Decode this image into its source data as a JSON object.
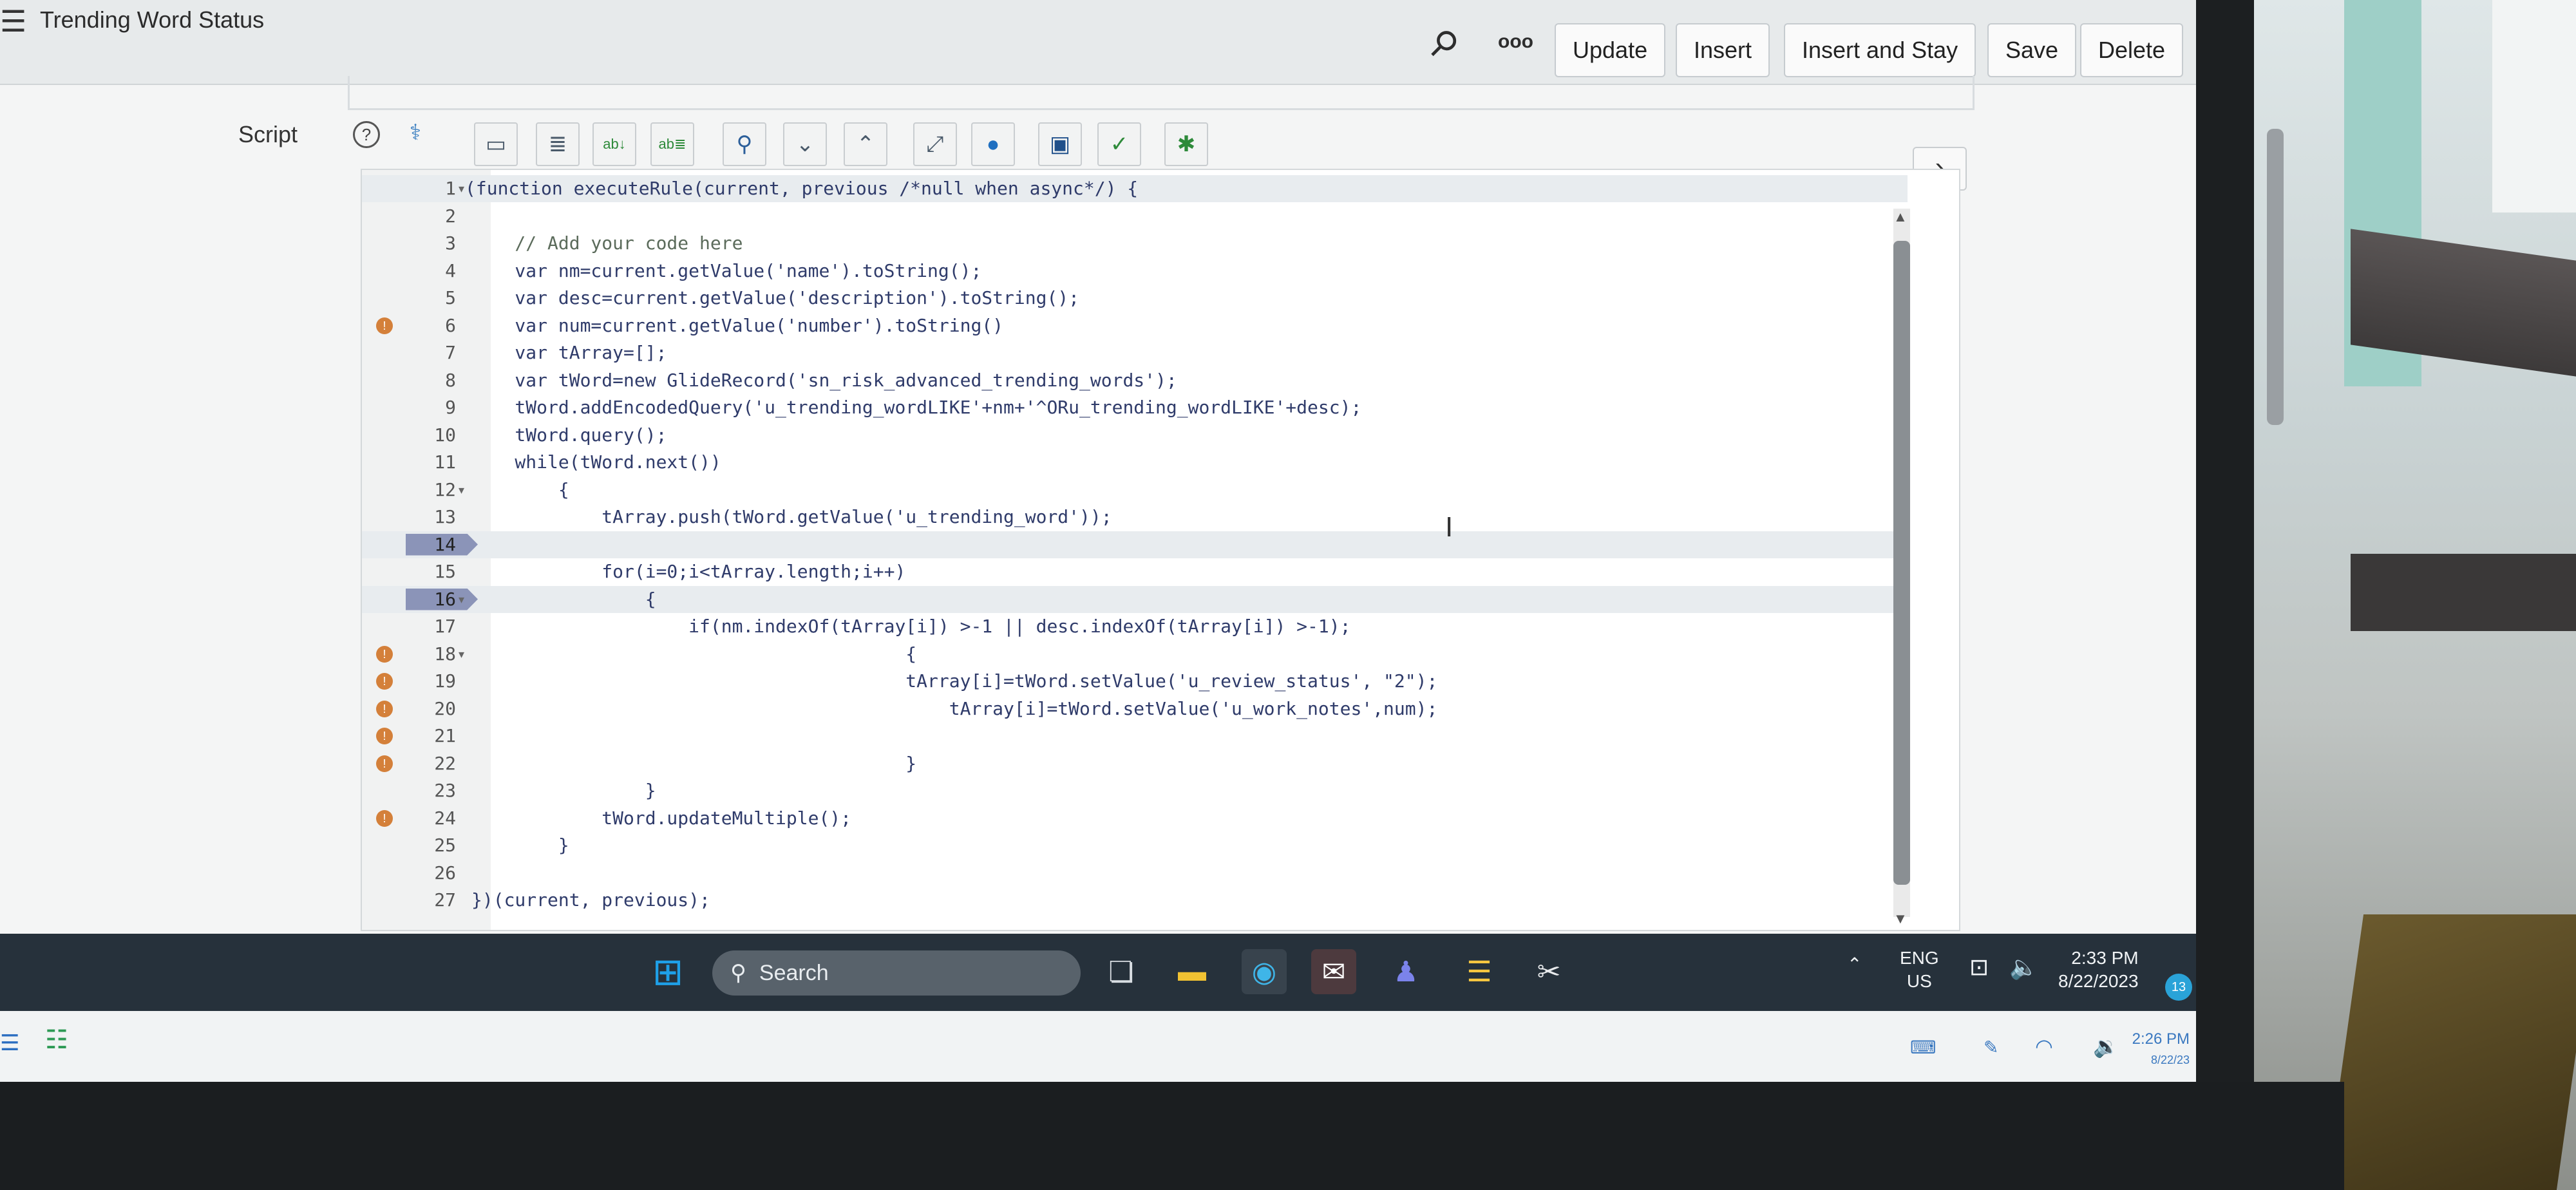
{
  "window": {
    "title": "Trending Word Status"
  },
  "header_buttons": {
    "update": "Update",
    "insert": "Insert",
    "insert_and_stay": "Insert and Stay",
    "save": "Save",
    "delete": "Delete",
    "more": "ooo"
  },
  "script": {
    "label": "Script"
  },
  "code_lines": [
    {
      "n": "1",
      "text": "(function executeRule(current, previous /*null when async*/) {"
    },
    {
      "n": "2",
      "text": ""
    },
    {
      "n": "3",
      "text": "    // Add your code here"
    },
    {
      "n": "4",
      "text": "    var nm=current.getValue('name').toString();"
    },
    {
      "n": "5",
      "text": "    var desc=current.getValue('description').toString();"
    },
    {
      "n": "6",
      "text": "    var num=current.getValue('number').toString()"
    },
    {
      "n": "7",
      "text": "    var tArray=[];"
    },
    {
      "n": "8",
      "text": "    var tWord=new GlideRecord('sn_risk_advanced_trending_words');"
    },
    {
      "n": "9",
      "text": "    tWord.addEncodedQuery('u_trending_wordLIKE'+nm+'^ORu_trending_wordLIKE'+desc);"
    },
    {
      "n": "10",
      "text": "    tWord.query();"
    },
    {
      "n": "11",
      "text": "    while(tWord.next())"
    },
    {
      "n": "12",
      "text": "        {"
    },
    {
      "n": "13",
      "text": "            tArray.push(tWord.getValue('u_trending_word'));"
    },
    {
      "n": "14",
      "text": ""
    },
    {
      "n": "15",
      "text": "            for(i=0;i<tArray.length;i++)"
    },
    {
      "n": "16",
      "text": "                {"
    },
    {
      "n": "17",
      "text": "                    if(nm.indexOf(tArray[i]) >-1 || desc.indexOf(tArray[i]) >-1);"
    },
    {
      "n": "18",
      "text": "                                        {"
    },
    {
      "n": "19",
      "text": "                                        tArray[i]=tWord.setValue('u_review_status', \"2\");"
    },
    {
      "n": "20",
      "text": "                                            tArray[i]=tWord.setValue('u_work_notes',num);"
    },
    {
      "n": "21",
      "text": ""
    },
    {
      "n": "22",
      "text": "                                        }"
    },
    {
      "n": "23",
      "text": "                }"
    },
    {
      "n": "24",
      "text": "            tWord.updateMultiple();"
    },
    {
      "n": "25",
      "text": "        }"
    },
    {
      "n": "26",
      "text": ""
    },
    {
      "n": "27",
      "text": "})(current, previous);"
    }
  ],
  "taskbar": {
    "search_placeholder": "Search",
    "language": "ENG",
    "region": "US",
    "time": "2:33 PM",
    "date": "8/22/2023",
    "notification_count": "13"
  },
  "secondary_bar": {
    "time": "2:26 PM",
    "date": "8/22/23"
  },
  "colors": {
    "breakpoint": "#d4803a",
    "header_bg": "#e7eaeb",
    "taskbar_bg": "#26313b"
  }
}
